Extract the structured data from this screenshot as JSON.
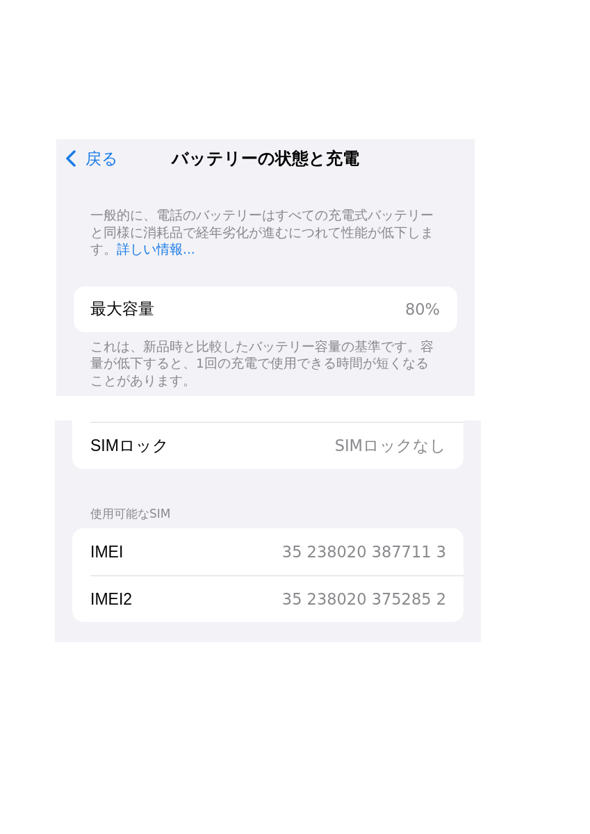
{
  "battery_screen": {
    "nav": {
      "back_label": "戻る",
      "title": "バッテリーの状態と充電"
    },
    "intro": {
      "text": "一般的に、電話のバッテリーはすべての充電式バッテリーと同様に消耗品で経年劣化が進むにつれて性能が低下します。",
      "link": "詳しい情報..."
    },
    "rows": [
      {
        "label": "最大容量",
        "value": "80%"
      }
    ],
    "footer": "これは、新品時と比較したバッテリー容量の基準です。容量が低下すると、1回の充電で使用できる時間が短くなることがあります。"
  },
  "sim_screen": {
    "rows": [
      {
        "label": "SIMロック",
        "value": "SIMロックなし"
      }
    ],
    "sections": [
      {
        "header": "使用可能なSIM",
        "rows": [
          {
            "label": "IMEI",
            "value": "35 238020 387711 3"
          },
          {
            "label": "IMEI2",
            "value": "35 238020 375285 2"
          }
        ]
      }
    ]
  }
}
